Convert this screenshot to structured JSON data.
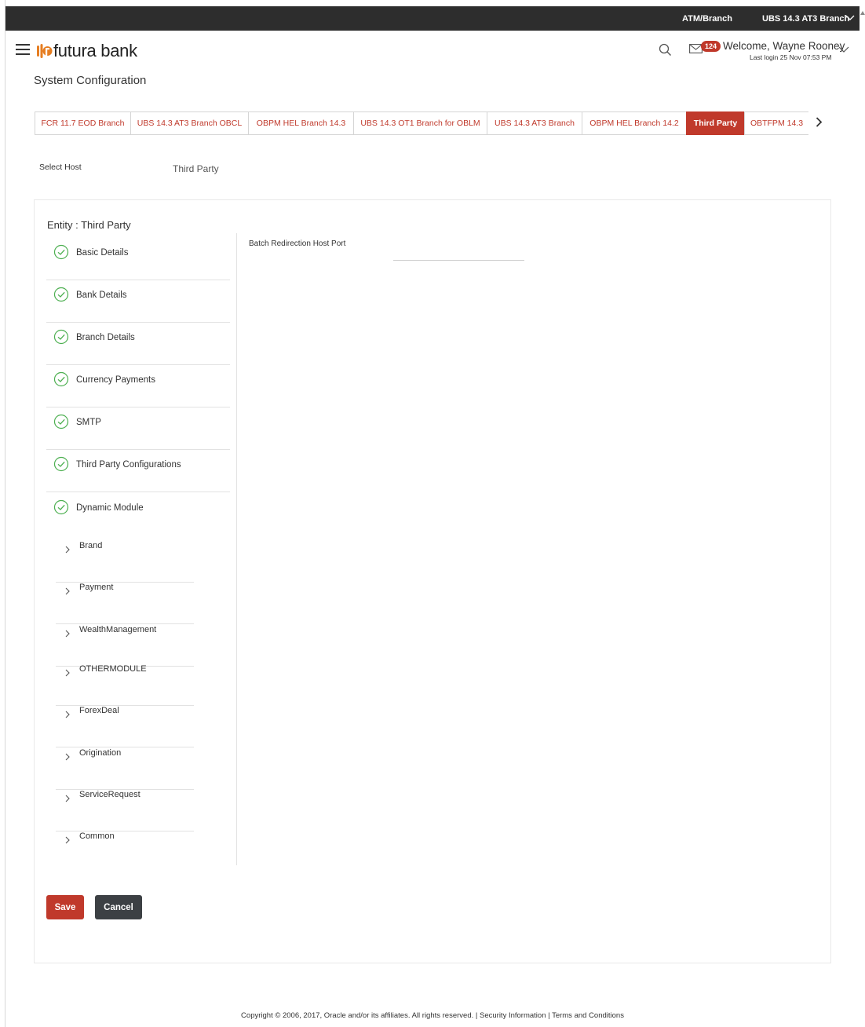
{
  "topbar": {
    "location_label": "ATM/Branch",
    "branch_label": "UBS 14.3 AT3 Branch"
  },
  "header": {
    "brand_name": "futura bank",
    "notification_count": "124",
    "welcome_text": "Welcome, Wayne Rooney",
    "last_login": "Last login 25 Nov 07:53 PM"
  },
  "page": {
    "title": "System Configuration"
  },
  "tabs": [
    {
      "label": "FCR 11.7 EOD Branch",
      "active": false
    },
    {
      "label": "UBS 14.3 AT3 Branch OBCL",
      "active": false
    },
    {
      "label": "OBPM HEL Branch 14.3",
      "active": false
    },
    {
      "label": "UBS 14.3 OT1 Branch for OBLM",
      "active": false
    },
    {
      "label": "UBS 14.3 AT3 Branch",
      "active": false
    },
    {
      "label": "OBPM HEL Branch 14.2",
      "active": false
    },
    {
      "label": "Third Party",
      "active": true
    },
    {
      "label": "OBTFPM 14.3",
      "active": false
    }
  ],
  "host": {
    "label": "Select Host",
    "value": "Third Party"
  },
  "entity": {
    "title": "Entity : Third Party"
  },
  "steps": [
    {
      "label": "Basic Details"
    },
    {
      "label": "Bank Details"
    },
    {
      "label": "Branch Details"
    },
    {
      "label": "Currency Payments"
    },
    {
      "label": "SMTP"
    },
    {
      "label": "Third Party Configurations"
    },
    {
      "label": "Dynamic Module"
    }
  ],
  "modules": [
    {
      "label": "Brand"
    },
    {
      "label": "Payment"
    },
    {
      "label": "WealthManagement"
    },
    {
      "label": "OTHERMODULE"
    },
    {
      "label": "ForexDeal"
    },
    {
      "label": "Origination"
    },
    {
      "label": "ServiceRequest"
    },
    {
      "label": "Common"
    }
  ],
  "form": {
    "field_label": "Batch Redirection Host Port",
    "field_value": ""
  },
  "actions": {
    "save_label": "Save",
    "cancel_label": "Cancel"
  },
  "footer": {
    "copyright": "Copyright © 2006, 2017, Oracle and/or its affiliates. All rights reserved. | ",
    "security_link": "Security Information",
    "separator": " | ",
    "terms_link": "Terms and Conditions"
  },
  "colors": {
    "accent": "#c0392b",
    "topbar": "#2d2d2d",
    "success": "#4caf50"
  }
}
